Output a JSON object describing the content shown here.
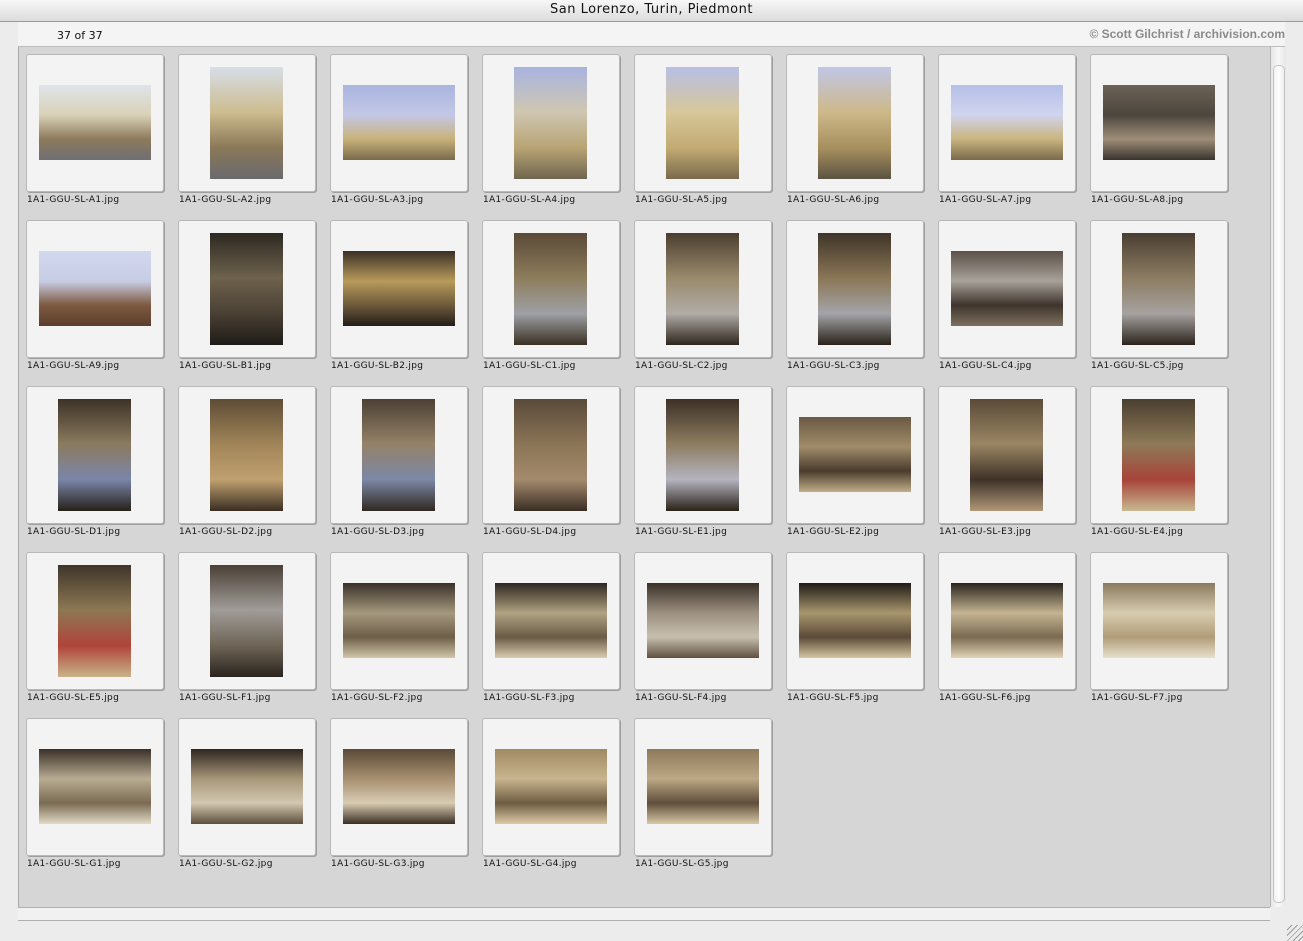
{
  "window": {
    "title": "San Lorenzo, Turin, Piedmont"
  },
  "header": {
    "count": "37 of 37",
    "credit": "© Scott Gilchrist / archivision.com"
  },
  "slides": [
    {
      "label": "1A1-GGU-SL-A1.jpg",
      "orientation": "landscape",
      "palette": [
        "#dfe4ea",
        "#d9d2b8",
        "#8d7a5c",
        "#6f6f73"
      ]
    },
    {
      "label": "1A1-GGU-SL-A2.jpg",
      "orientation": "portrait",
      "palette": [
        "#d7dee8",
        "#cdbd8f",
        "#8a7858",
        "#6a6a6e"
      ]
    },
    {
      "label": "1A1-GGU-SL-A3.jpg",
      "orientation": "landscape",
      "palette": [
        "#a9b4e0",
        "#c4c8e6",
        "#c8b27a",
        "#7a6a4a"
      ]
    },
    {
      "label": "1A1-GGU-SL-A4.jpg",
      "orientation": "portrait",
      "palette": [
        "#a8b3e0",
        "#cfc7b2",
        "#b8a474",
        "#6f6650"
      ]
    },
    {
      "label": "1A1-GGU-SL-A5.jpg",
      "orientation": "portrait",
      "palette": [
        "#b7bfe6",
        "#d7c79a",
        "#c3ab74",
        "#7a6a4c"
      ]
    },
    {
      "label": "1A1-GGU-SL-A6.jpg",
      "orientation": "portrait",
      "palette": [
        "#c1c6e6",
        "#cdb98a",
        "#a8905e",
        "#5b5342"
      ]
    },
    {
      "label": "1A1-GGU-SL-A7.jpg",
      "orientation": "landscape",
      "palette": [
        "#b6bfe8",
        "#d0d4ee",
        "#c9b580",
        "#7a6a4a"
      ]
    },
    {
      "label": "1A1-GGU-SL-A8.jpg",
      "orientation": "landscape",
      "palette": [
        "#6c6256",
        "#4c463e",
        "#9e8e78",
        "#3a342e"
      ]
    },
    {
      "label": "1A1-GGU-SL-A9.jpg",
      "orientation": "landscape",
      "palette": [
        "#d2d8ee",
        "#c8cde6",
        "#7e5a40",
        "#5a3e2c"
      ]
    },
    {
      "label": "1A1-GGU-SL-B1.jpg",
      "orientation": "portrait",
      "palette": [
        "#2c2822",
        "#6e624c",
        "#4a4034",
        "#1e1b17"
      ]
    },
    {
      "label": "1A1-GGU-SL-B2.jpg",
      "orientation": "landscape",
      "palette": [
        "#3a3026",
        "#b89a5a",
        "#6e5a3c",
        "#241e18"
      ]
    },
    {
      "label": "1A1-GGU-SL-C1.jpg",
      "orientation": "portrait",
      "palette": [
        "#5a4a36",
        "#8e7c5c",
        "#9ea0a4",
        "#3a3024"
      ]
    },
    {
      "label": "1A1-GGU-SL-C2.jpg",
      "orientation": "portrait",
      "palette": [
        "#4a3e30",
        "#9a8a6c",
        "#b0aca6",
        "#2e261e"
      ]
    },
    {
      "label": "1A1-GGU-SL-C3.jpg",
      "orientation": "portrait",
      "palette": [
        "#3e3428",
        "#8a7656",
        "#a4a4a8",
        "#2a221a"
      ]
    },
    {
      "label": "1A1-GGU-SL-C4.jpg",
      "orientation": "landscape",
      "palette": [
        "#5a5048",
        "#a8a29a",
        "#3e342c",
        "#7e7060"
      ]
    },
    {
      "label": "1A1-GGU-SL-C5.jpg",
      "orientation": "portrait",
      "palette": [
        "#4a3e32",
        "#8c7c62",
        "#a6a2a0",
        "#2c241c"
      ]
    },
    {
      "label": "1A1-GGU-SL-D1.jpg",
      "orientation": "portrait",
      "palette": [
        "#3c3228",
        "#8a7a5e",
        "#7a86a8",
        "#262018"
      ]
    },
    {
      "label": "1A1-GGU-SL-D2.jpg",
      "orientation": "portrait",
      "palette": [
        "#5e4c36",
        "#a08458",
        "#c0a070",
        "#3a2e22"
      ]
    },
    {
      "label": "1A1-GGU-SL-D3.jpg",
      "orientation": "portrait",
      "palette": [
        "#4c4034",
        "#948268",
        "#7c88a6",
        "#302820"
      ]
    },
    {
      "label": "1A1-GGU-SL-D4.jpg",
      "orientation": "portrait",
      "palette": [
        "#5a4a3a",
        "#8a7456",
        "#a48a6e",
        "#3a2e24"
      ]
    },
    {
      "label": "1A1-GGU-SL-E1.jpg",
      "orientation": "portrait",
      "palette": [
        "#3c3026",
        "#8c7c60",
        "#b4b4c0",
        "#2a2218"
      ]
    },
    {
      "label": "1A1-GGU-SL-E2.jpg",
      "orientation": "landscape",
      "palette": [
        "#6a5a44",
        "#a08c6a",
        "#4a3c2e",
        "#c0ae88"
      ]
    },
    {
      "label": "1A1-GGU-SL-E3.jpg",
      "orientation": "portrait",
      "palette": [
        "#5a4a38",
        "#9a8664",
        "#3e3228",
        "#b09878"
      ]
    },
    {
      "label": "1A1-GGU-SL-E4.jpg",
      "orientation": "portrait",
      "palette": [
        "#4a3e30",
        "#8e7a58",
        "#a8443a",
        "#c8b890"
      ]
    },
    {
      "label": "1A1-GGU-SL-E5.jpg",
      "orientation": "portrait",
      "palette": [
        "#3e342a",
        "#8c7854",
        "#b0443a",
        "#c8b48a"
      ]
    },
    {
      "label": "1A1-GGU-SL-F1.jpg",
      "orientation": "portrait",
      "palette": [
        "#4a4036",
        "#a09c98",
        "#6e6456",
        "#2a241e"
      ]
    },
    {
      "label": "1A1-GGU-SL-F2.jpg",
      "orientation": "landscape",
      "palette": [
        "#3a3028",
        "#a4987e",
        "#6e5e48",
        "#d0c6a8"
      ]
    },
    {
      "label": "1A1-GGU-SL-F3.jpg",
      "orientation": "landscape",
      "palette": [
        "#2e2620",
        "#b0a282",
        "#6a5a46",
        "#d8ccb0"
      ]
    },
    {
      "label": "1A1-GGU-SL-F4.jpg",
      "orientation": "landscape",
      "palette": [
        "#3a3028",
        "#9c9080",
        "#c8c0ae",
        "#5e5040"
      ]
    },
    {
      "label": "1A1-GGU-SL-F5.jpg",
      "orientation": "landscape",
      "palette": [
        "#1e1a16",
        "#a8966e",
        "#5a4a38",
        "#d4c6a2"
      ]
    },
    {
      "label": "1A1-GGU-SL-F6.jpg",
      "orientation": "landscape",
      "palette": [
        "#2a241e",
        "#c4b492",
        "#7a6a52",
        "#e0d4b6"
      ]
    },
    {
      "label": "1A1-GGU-SL-F7.jpg",
      "orientation": "landscape",
      "palette": [
        "#8a7a5e",
        "#d8ccb0",
        "#b09c78",
        "#e8e0cc"
      ]
    },
    {
      "label": "1A1-GGU-SL-G1.jpg",
      "orientation": "landscape",
      "palette": [
        "#3a3028",
        "#b8ac92",
        "#7a6a52",
        "#e2dac6"
      ]
    },
    {
      "label": "1A1-GGU-SL-G2.jpg",
      "orientation": "landscape",
      "palette": [
        "#2e2620",
        "#a8987a",
        "#d2c8b0",
        "#5e4e3c"
      ]
    },
    {
      "label": "1A1-GGU-SL-G3.jpg",
      "orientation": "landscape",
      "palette": [
        "#5a4a38",
        "#a89070",
        "#d8ccb4",
        "#3a2e22"
      ]
    },
    {
      "label": "1A1-GGU-SL-G4.jpg",
      "orientation": "landscape",
      "palette": [
        "#a08a64",
        "#c8b48e",
        "#6e5c42",
        "#dccaa6"
      ]
    },
    {
      "label": "1A1-GGU-SL-G5.jpg",
      "orientation": "landscape",
      "palette": [
        "#8e7a5c",
        "#bca884",
        "#5e4e3a",
        "#d8c8a6"
      ]
    }
  ]
}
